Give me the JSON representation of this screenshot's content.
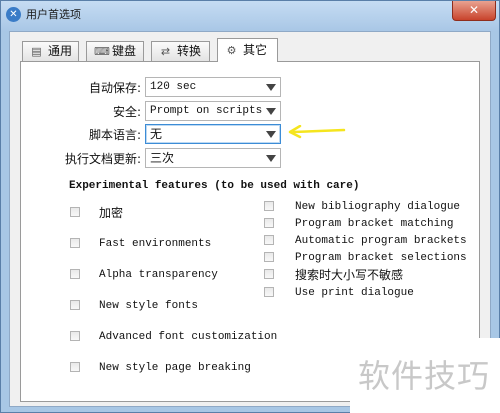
{
  "window": {
    "title": "用户首选项",
    "close_glyph": "✕"
  },
  "tabs": [
    {
      "label": "通用",
      "icon": "general-icon"
    },
    {
      "label": "键盘",
      "icon": "keyboard-icon"
    },
    {
      "label": "转换",
      "icon": "convert-icon"
    },
    {
      "label": "其它",
      "icon": "gear-icon",
      "active": true
    }
  ],
  "settings": {
    "autosave": {
      "label": "自动保存:",
      "value": "120 sec"
    },
    "security": {
      "label": "安全:",
      "value": "Prompt on scripts"
    },
    "script_language": {
      "label": "脚本语言:",
      "value": "无"
    },
    "doc_update": {
      "label": "执行文档更新:",
      "value": "三次"
    }
  },
  "experimental": {
    "title": "Experimental features (to be used with care)",
    "left": [
      {
        "label": "加密",
        "checked": false
      },
      {
        "label": "Fast environments",
        "checked": false
      },
      {
        "label": "Alpha transparency",
        "checked": false
      },
      {
        "label": "New style fonts",
        "checked": false
      },
      {
        "label": "Advanced font customization",
        "checked": false
      },
      {
        "label": "New style page breaking",
        "checked": false
      }
    ],
    "right": [
      {
        "label": "New bibliography dialogue",
        "checked": false
      },
      {
        "label": "Program bracket matching",
        "checked": false
      },
      {
        "label": "Automatic program brackets",
        "checked": false
      },
      {
        "label": "Program bracket selections",
        "checked": false
      },
      {
        "label": "搜索时大小写不敏感",
        "checked": false
      },
      {
        "label": "Use print dialogue",
        "checked": false
      }
    ]
  },
  "annotation": {
    "arrow_color": "#f5e51e"
  },
  "watermark": "软件技巧"
}
